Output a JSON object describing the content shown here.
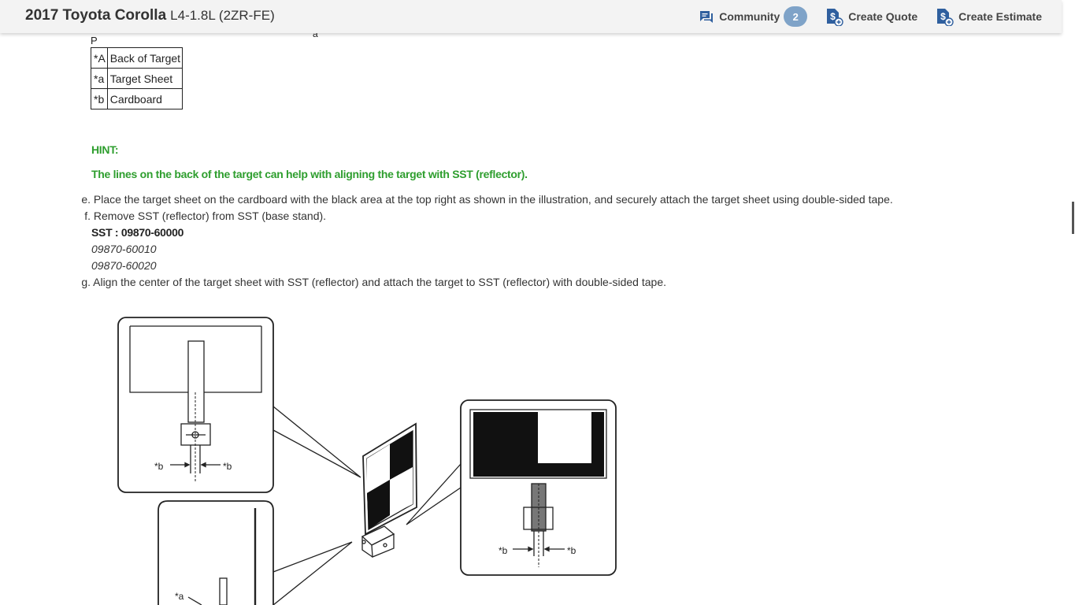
{
  "header": {
    "vehicle_title": "2017 Toyota Corolla",
    "vehicle_engine": "L4-1.8L (2ZR-FE)",
    "community_label": "Community",
    "community_count": "2",
    "quote_label": "Create Quote",
    "estimate_label": "Create Estimate",
    "accent_color": "#2f5f9e"
  },
  "fragments": {
    "top_left": "P",
    "top_mid": "a"
  },
  "legend": [
    {
      "key": "*A",
      "text": "Back of Target"
    },
    {
      "key": "*a",
      "text": "Target Sheet"
    },
    {
      "key": "*b",
      "text": "Cardboard"
    }
  ],
  "hint": {
    "heading": "HINT:",
    "text": "The lines on the back of the target can help with aligning the target with SST (reflector).",
    "color": "#2e9e2e"
  },
  "steps": {
    "e": {
      "marker": "e.",
      "text": "Place the target sheet on the cardboard with the black area at the top right as shown in the illustration, and securely attach the target sheet using double-sided tape."
    },
    "f": {
      "marker": "f.",
      "text": "Remove SST (reflector) from SST (base stand)."
    },
    "sst": {
      "code": "SST : 09870-60000",
      "alt1": "09870-60010",
      "alt2": "09870-60020"
    },
    "g": {
      "marker": "g.",
      "text": "Align the center of the target sheet with SST (reflector) and attach the target to SST (reflector) with double-sided tape."
    }
  },
  "illustration": {
    "label_b": "*b",
    "label_a": "*a"
  }
}
